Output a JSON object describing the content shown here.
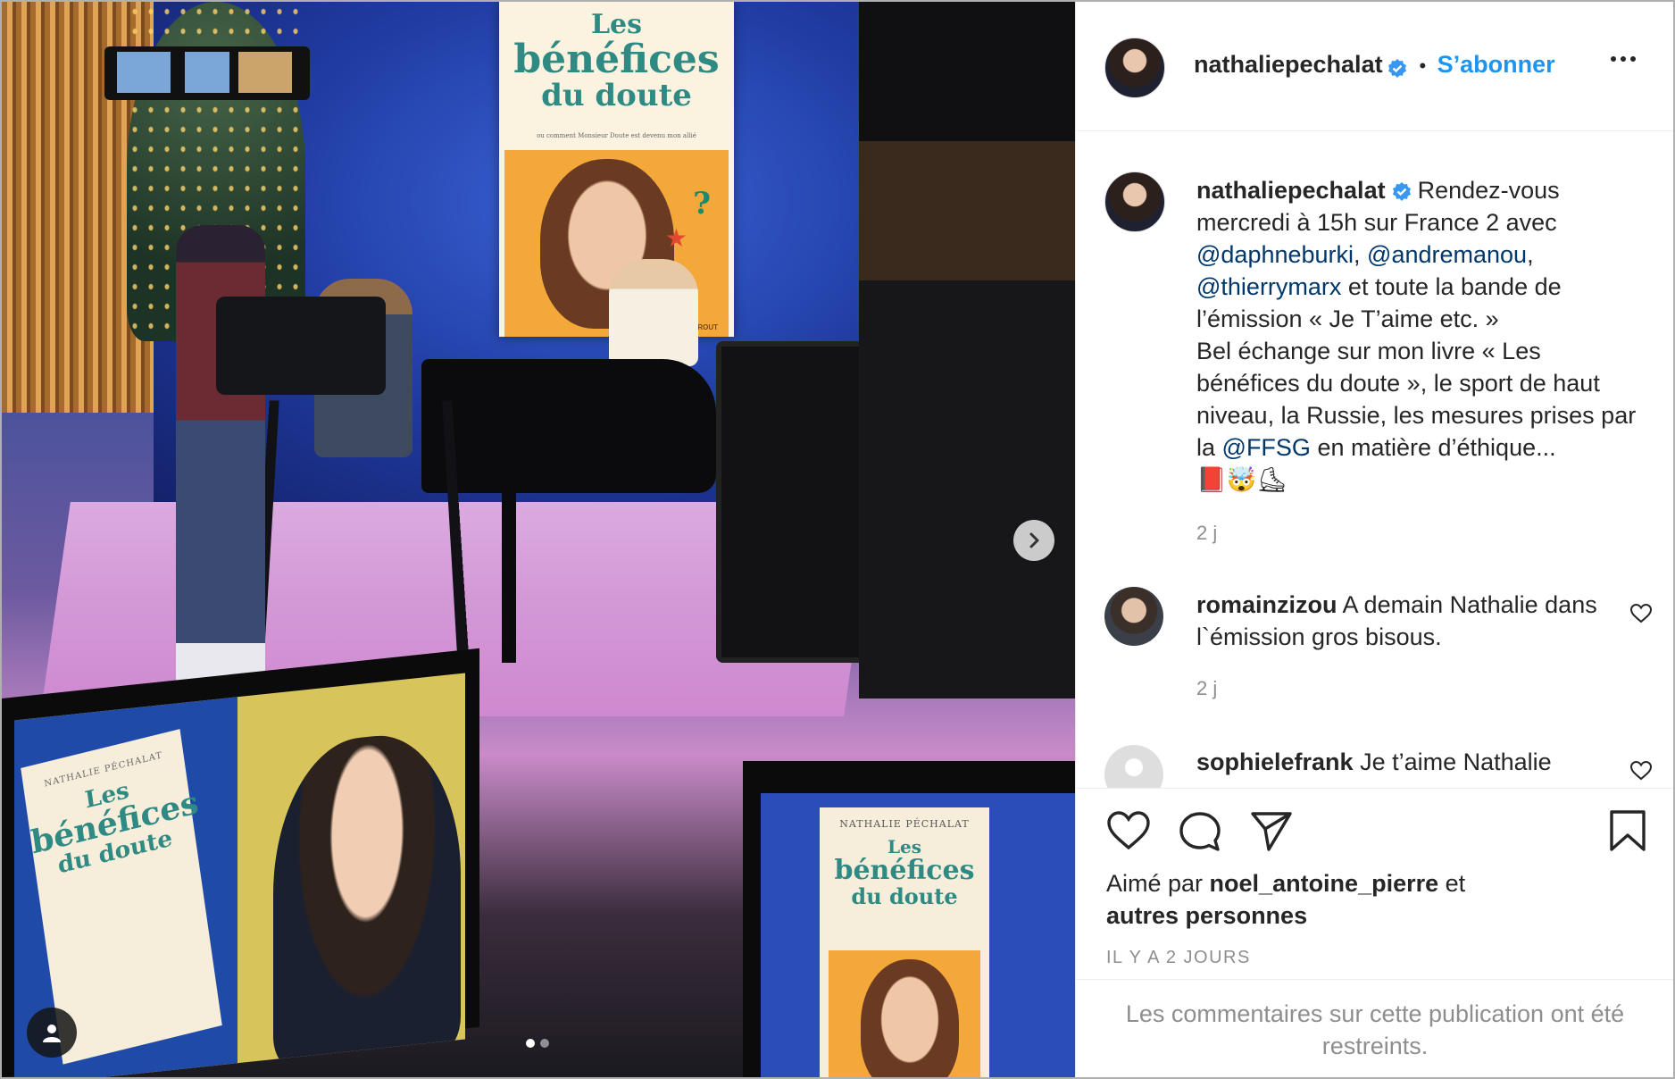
{
  "post": {
    "username": "nathaliepechalat",
    "follow_label": "S’abonner",
    "separator": "•",
    "image": {
      "poster_book": {
        "line1": "Les",
        "line2": "bénéfices",
        "line3": "du doute",
        "subtitle": "ou comment Monsieur Doute est devenu mon allié",
        "publisher": "MAROUT"
      },
      "left_monitor_book": {
        "author": "NATHALIE PÉCHALAT",
        "line1": "Les",
        "line2": "bénéfices",
        "line3": "du doute"
      },
      "right_monitor_book": {
        "author": "NATHALIE PÉCHALAT",
        "line1": "Les",
        "line2": "bénéfices",
        "line3": "du doute"
      },
      "carousel_total": 2,
      "carousel_current": 1
    }
  },
  "caption": {
    "username": "nathaliepechalat",
    "text_before": "Rendez-vous mercredi à 15h sur France 2 avec ",
    "mention1": "@daphneburki",
    "sep1": ", ",
    "mention2": "@andremanou",
    "sep2": ",",
    "mention3": "@thierrymarx",
    "text_middle": " et toute la bande de l’émission « Je T’aime etc. »",
    "line2_before": "Bel échange sur mon livre « Les bénéfices du doute », le sport de haut niveau, la Russie, les mesures prises par la ",
    "mention4": "@FFSG",
    "line2_after": " en matière d’éthique...",
    "emojis": "📕🤯⛸",
    "time": "2 j"
  },
  "comments": [
    {
      "username": "romainzizou",
      "text": "A demain Nathalie dans l`émission gros bisous.",
      "time": "2 j"
    },
    {
      "username": "sophielefrank",
      "text": "Je t’aime Nathalie"
    }
  ],
  "likes": {
    "prefix": "Aimé par ",
    "user": "noel_antoine_pierre",
    "and": " et",
    "others": "autres personnes"
  },
  "date_label": "IL Y A 2 JOURS",
  "restricted_text": "Les commentaires sur cette publication ont été restreints.",
  "colors": {
    "follow": "#1d95f0",
    "verified": "#3897f0",
    "mention": "#00376b"
  },
  "icons": [
    "verified-badge-icon",
    "more-options-icon",
    "chevron-right-icon",
    "user-tag-icon",
    "heart-icon",
    "comment-icon",
    "share-icon",
    "bookmark-icon"
  ]
}
